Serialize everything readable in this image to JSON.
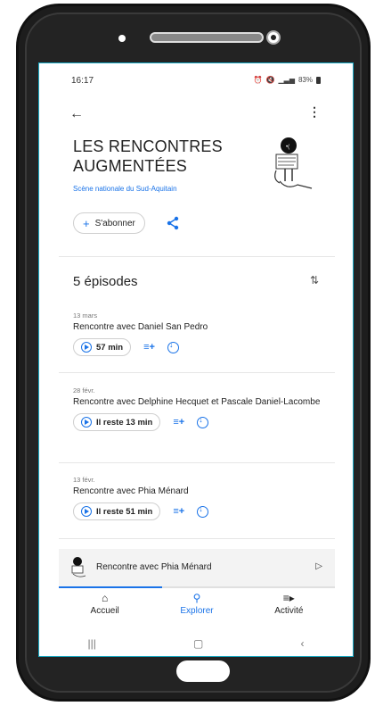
{
  "status": {
    "time": "16:17",
    "battery": "83%"
  },
  "podcast": {
    "title_line1": "LES RENCONTRES",
    "title_line2": "AUGMENTÉES",
    "publisher": "Scène nationale du Sud-Aquitain",
    "subscribe_label": "S'abonner"
  },
  "episodes": {
    "heading": "5 épisodes",
    "items": [
      {
        "date": "13 mars",
        "title": "Rencontre avec Daniel San Pedro",
        "play_label": "57 min"
      },
      {
        "date": "28 févr.",
        "title": "Rencontre avec Delphine Hecquet et Pascale Daniel-Lacombe",
        "play_label": "Il reste 13 min"
      },
      {
        "date": "13 févr.",
        "title": "Rencontre avec Phia Ménard",
        "play_label": "Il reste 51 min"
      }
    ]
  },
  "mini_player": {
    "title": "Rencontre avec Phia Ménard"
  },
  "nav": [
    {
      "label": "Accueil",
      "icon": "home-icon"
    },
    {
      "label": "Explorer",
      "icon": "search-icon"
    },
    {
      "label": "Activité",
      "icon": "activity-icon"
    }
  ],
  "colors": {
    "accent": "#1a73e8",
    "frame": "#1d1d1d",
    "screen_border": "#19a9c4"
  }
}
